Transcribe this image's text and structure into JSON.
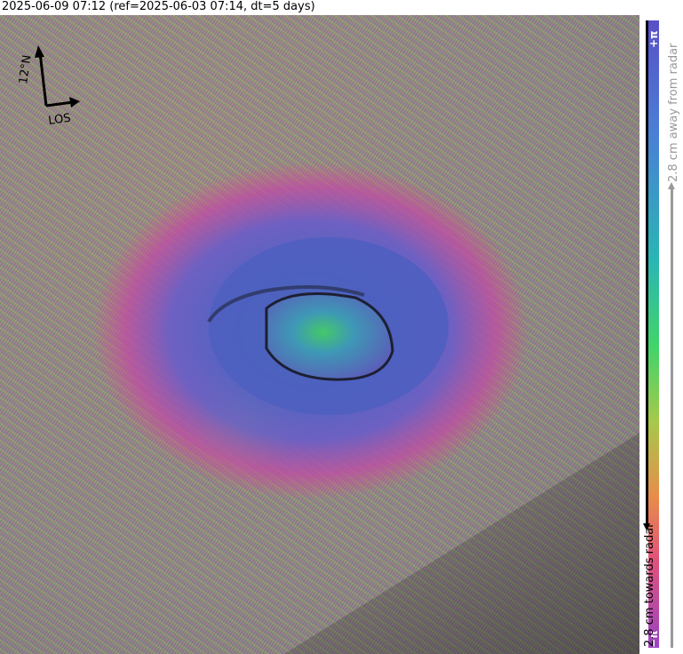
{
  "header": {
    "title": "2025-06-09 07:12 (ref=2025-06-03 07:14, dt=5 days)"
  },
  "compass": {
    "north_label": "12°N",
    "los_label": "LOS"
  },
  "colorbar": {
    "top_symbol": "+π",
    "bottom_symbol": "−π",
    "label_away": "2.8 cm away from radar",
    "label_towards": "2.8 cm towards radar",
    "colors": [
      "#5a4fc8",
      "#4a7fd6",
      "#2ab5b4",
      "#41d46a",
      "#a6c94a",
      "#e88c4a",
      "#e0527a",
      "#9b43c4"
    ]
  }
}
